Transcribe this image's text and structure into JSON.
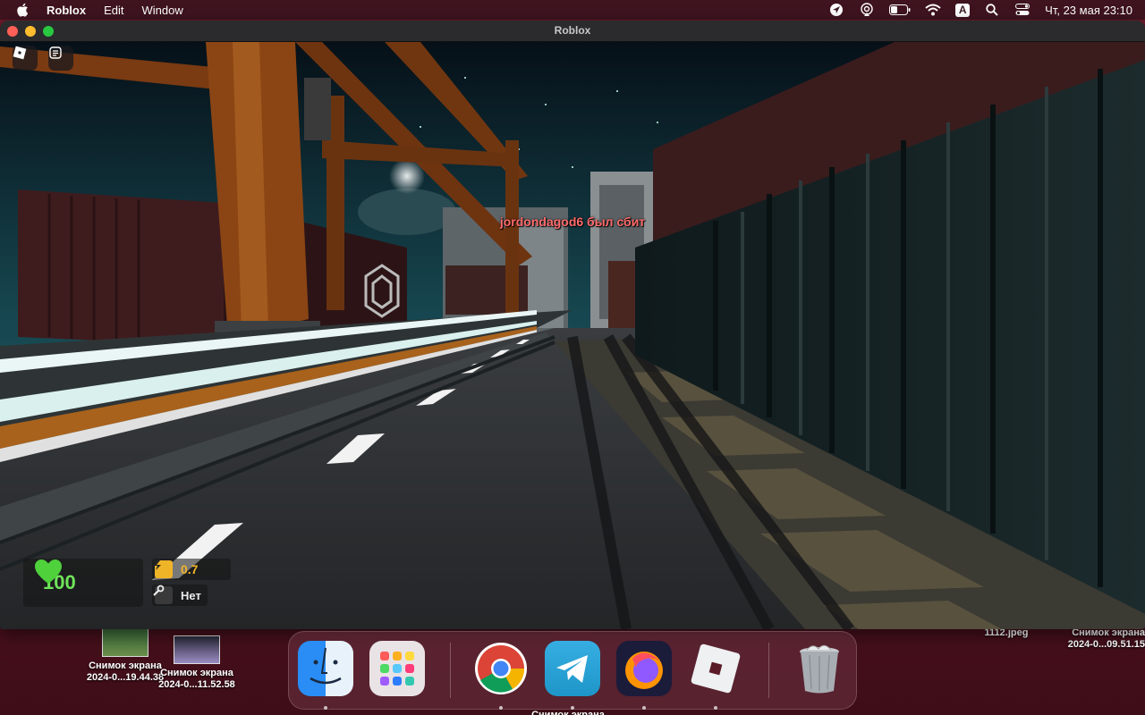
{
  "menubar": {
    "app_name": "Roblox",
    "menu_edit": "Edit",
    "menu_window": "Window",
    "input_source": "A",
    "datetime": "Чт, 23 мая  23:10"
  },
  "window": {
    "title": "Roblox"
  },
  "game": {
    "kill_feed": "jordondagod6 был сбит",
    "health": "100",
    "speed_value": "0.7",
    "weapon_label": "Нет"
  },
  "desktop_files": [
    {
      "label_line1": "Снимок экрана",
      "label_line2": "2024-0...19.44.38"
    },
    {
      "label_line1": "Снимок экрана",
      "label_line2": "2024-0...11.52.58"
    },
    {
      "label_line1": "Снимок экрана",
      "label_line2": "2024-0...09.51.15"
    },
    {
      "label_line1": "1112.jpeg",
      "label_line2": ""
    }
  ],
  "dock": {
    "items": [
      "finder-icon",
      "launchpad-icon",
      "chrome-icon",
      "telegram-icon",
      "firefox-icon",
      "roblox-icon",
      "trash-icon"
    ],
    "partial_label": "Снимок экрана"
  },
  "colors": {
    "health_green": "#6fe55a",
    "speed_orange": "#f0b429",
    "kill_feed_red": "#ff6b6b"
  }
}
